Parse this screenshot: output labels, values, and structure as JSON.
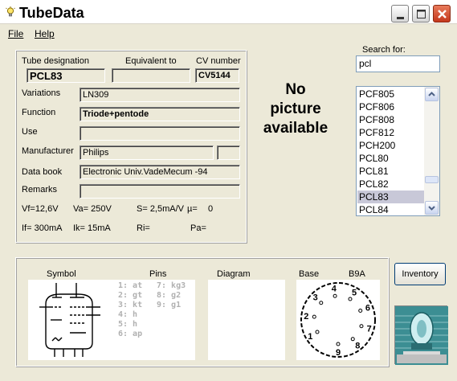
{
  "window": {
    "title": "TubeData"
  },
  "menu": {
    "file": "File",
    "help": "Help"
  },
  "tube": {
    "labels": {
      "designation": "Tube designation",
      "equivalent": "Equivalent to",
      "cv": "CV number",
      "variations": "Variations",
      "function": "Function",
      "use": "Use",
      "manufacturer": "Manufacturer",
      "databook": "Data book",
      "remarks": "Remarks"
    },
    "designation": "PCL83",
    "equivalent": "",
    "cv": "CV5144",
    "variations": "LN309",
    "function": "Triode+pentode",
    "use": "",
    "manufacturer": "Philips",
    "manufacturer_code": "",
    "databook": "Electronic Univ.VadeMecum -94",
    "remarks": "",
    "params": {
      "vf": "Vf=12,6V",
      "va": "Va= 250V",
      "s": "S= 2,5mA/V",
      "mu": "µ=",
      "mu_val": "0",
      "if": "If= 300mA",
      "ik": "Ik= 15mA",
      "ri": "Ri=",
      "pa": "Pa="
    }
  },
  "picture": {
    "line1": "No",
    "line2": "picture",
    "line3": "available"
  },
  "search": {
    "label": "Search for:",
    "value": "pcl",
    "results": [
      "PCF805",
      "PCF806",
      "PCF808",
      "PCF812",
      "PCH200",
      "PCL80",
      "PCL81",
      "PCL82",
      "PCL83",
      "PCL84"
    ],
    "selected": "PCL83"
  },
  "bottom": {
    "symbol_label": "Symbol",
    "pins_label": "Pins",
    "diagram_label": "Diagram",
    "base_label": "Base",
    "base_type": "B9A",
    "pins_col1": [
      "1: at",
      "2: gt",
      "3: kt",
      "4: h",
      "5: h",
      "6: ap"
    ],
    "pins_col2": [
      "7: kg3",
      "8: g2",
      "9: g1"
    ],
    "base_pins": [
      "1",
      "2",
      "3",
      "4",
      "5",
      "6",
      "7",
      "8",
      "9"
    ]
  },
  "inventory": {
    "label": "Inventory"
  },
  "colors": {
    "face": "#ece9d8",
    "selection": "#c8c8d8",
    "close": "#c4371c",
    "logo": "#3c8e93"
  },
  "icons": {
    "app": "lightbulb-icon",
    "close": "close-icon",
    "minimize": "minimize-icon",
    "maximize": "maximize-icon"
  }
}
